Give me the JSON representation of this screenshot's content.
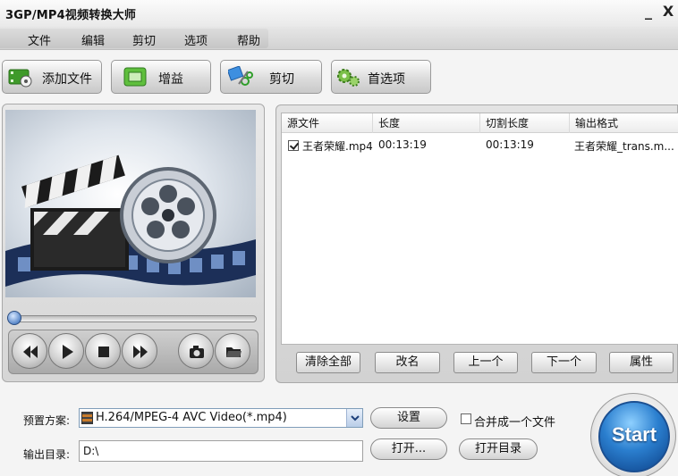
{
  "window": {
    "title": "3GP/MP4视频转换大师",
    "minimize_label": "_",
    "close_label": "X"
  },
  "menu": {
    "items": [
      "文件",
      "编辑",
      "剪切",
      "选项",
      "帮助"
    ]
  },
  "toolbar": {
    "add_file": "添加文件",
    "gain": "增益",
    "cut": "剪切",
    "preferences": "首选项"
  },
  "file_list": {
    "columns": [
      "源文件",
      "长度",
      "切割长度",
      "输出格式"
    ],
    "rows": [
      {
        "checked": true,
        "source": "王者荣耀.mp4",
        "length": "00:13:19",
        "cut_length": "00:13:19",
        "output": "王者荣耀_trans.m..."
      }
    ],
    "buttons": {
      "clear_all": "清除全部",
      "rename": "改名",
      "up": "上一个",
      "down": "下一个",
      "properties": "属性"
    }
  },
  "output": {
    "preset_label": "预置方案:",
    "preset_value": "H.264/MPEG-4 AVC Video(*.mp4)",
    "settings_button": "设置",
    "merge_label": "合并成一个文件",
    "dir_label": "输出目录:",
    "dir_value": "D:\\",
    "open_button": "打开...",
    "open_dir_button": "打开目录"
  },
  "start": {
    "label": "Start"
  },
  "colors": {
    "accent": "#2b7fcf",
    "toolbar_green": "#4fae2f"
  }
}
